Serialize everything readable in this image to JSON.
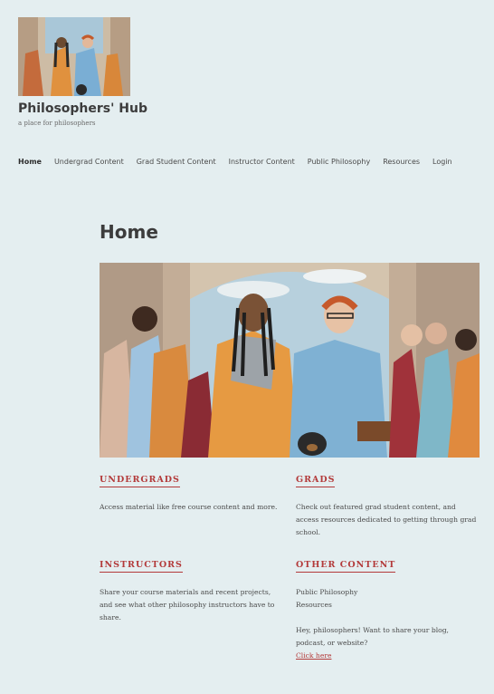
{
  "site": {
    "title": "Philosophers' Hub",
    "tagline": "a place for philosophers"
  },
  "nav": {
    "items": [
      {
        "label": "Home"
      },
      {
        "label": "Undergrad Content"
      },
      {
        "label": "Grad Student Content"
      },
      {
        "label": "Instructor Content"
      },
      {
        "label": "Public Philosophy"
      },
      {
        "label": "Resources"
      },
      {
        "label": "Login"
      }
    ]
  },
  "page": {
    "title": "Home"
  },
  "sections": {
    "undergrads": {
      "heading": "UNDERGRADS",
      "text": "Access material like free course content and more."
    },
    "grads": {
      "heading": "GRADS",
      "text": "Check out featured grad student content, and access resources dedicated to getting through grad school."
    },
    "instructors": {
      "heading": "INSTRUCTORS",
      "text": "Share your course materials and recent projects, and see what other philosophy instructors have to share."
    },
    "other": {
      "heading": "OTHER CONTENT",
      "line1": "Public Philosophy",
      "line2": "Resources",
      "text": "Hey, philosophers! Want to share your blog, podcast, or website?",
      "link": "Click here"
    }
  },
  "colors": {
    "background": "#e4eef0",
    "accent": "#b33a3a",
    "text": "#4a4a4a"
  }
}
